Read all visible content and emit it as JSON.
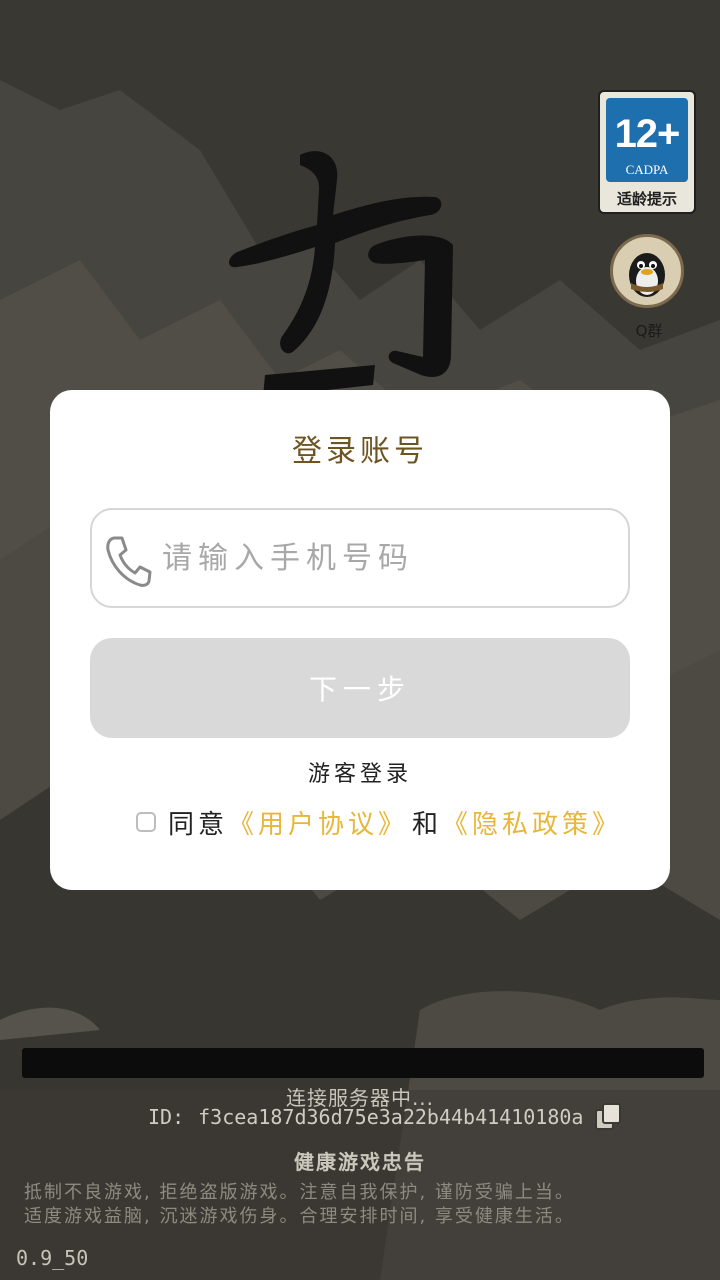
{
  "age_rating": {
    "rating": "12+",
    "org": "CADPA",
    "caption": "适龄提示"
  },
  "qq_group": {
    "label": "Q群",
    "icon": "qq-penguin-icon"
  },
  "login_dialog": {
    "title": "登录账号",
    "phone_placeholder": "请输入手机号码",
    "phone_value": "",
    "next_label": "下一步",
    "guest_login_label": "游客登录",
    "agree_label": "同意",
    "user_agreement_link": "《用户协议》",
    "and_label": "和",
    "privacy_policy_link": "《隐私政策》",
    "agreed": false
  },
  "footer": {
    "connecting": "连接服务器中...",
    "device_id_label": "ID:",
    "device_id_value": "f3cea187d36d75e3a22b44b41410180a",
    "health_title": "健康游戏忠告",
    "health_line1": "抵制不良游戏, 拒绝盗版游戏。注意自我保护, 谨防受骗上当。",
    "health_line2": "适度游戏益脑, 沉迷游戏伤身。合理安排时间, 享受健康生活。",
    "version": "0.9_50"
  },
  "colors": {
    "link": "#e8b638",
    "title": "#6e5420",
    "button_disabled": "#d9d9d9"
  }
}
